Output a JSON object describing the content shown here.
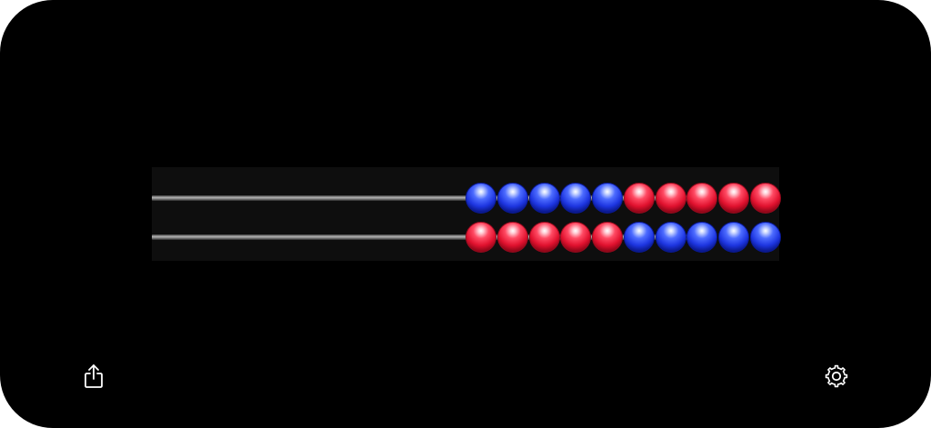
{
  "app": {
    "name": "abacus"
  },
  "abacus": {
    "rows": [
      {
        "beads": [
          "blue",
          "blue",
          "blue",
          "blue",
          "blue",
          "red",
          "red",
          "red",
          "red",
          "red"
        ]
      },
      {
        "beads": [
          "red",
          "red",
          "red",
          "red",
          "red",
          "blue",
          "blue",
          "blue",
          "blue",
          "blue"
        ]
      }
    ]
  },
  "toolbar": {
    "share_icon": "share-icon",
    "settings_icon": "gear-icon"
  },
  "colors": {
    "background": "#000000",
    "frame": "#0e0e0e",
    "blue_bead": "#1d35e0",
    "red_bead": "#e0112e",
    "icon": "#ffffff"
  }
}
